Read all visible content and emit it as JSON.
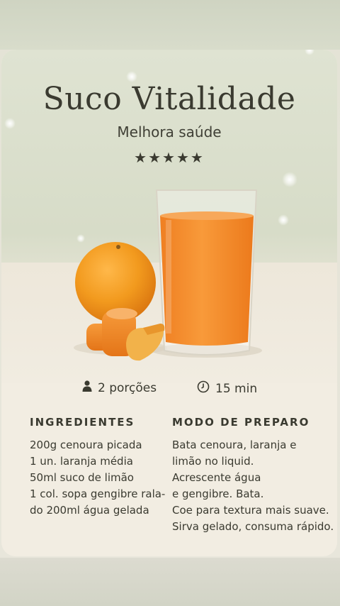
{
  "recipe": {
    "title": "Suco Vitalidade",
    "subtitle": "Melhora saúde",
    "rating_stars": "★★★★★",
    "rating": 5,
    "servings": "2 porções",
    "time": "15 min",
    "ingredients_title": "INGREDIENTES",
    "ingredients": [
      "200g cenoura picada",
      "1 un. laranja média",
      "50ml suco de limão",
      "1 col. sopa gengibre rala-",
      "do  200ml água gelada"
    ],
    "steps_title": "MODO DE PREPARO",
    "steps": [
      "Bata cenoura, laranja e",
      "limão no liquid.",
      "Acrescente água",
      "e gengibre. Bata.",
      "Coe para textura mais suave.",
      "Sirva gelado, consuma rápido."
    ]
  },
  "icons": {
    "servings": "person-icon",
    "time": "clock-icon"
  },
  "colors": {
    "text": "#3a3a30",
    "juice": "#f08a2c",
    "orange": "#f29a1e",
    "carrot": "#ee8a2a",
    "ginger": "#f2b24a"
  }
}
